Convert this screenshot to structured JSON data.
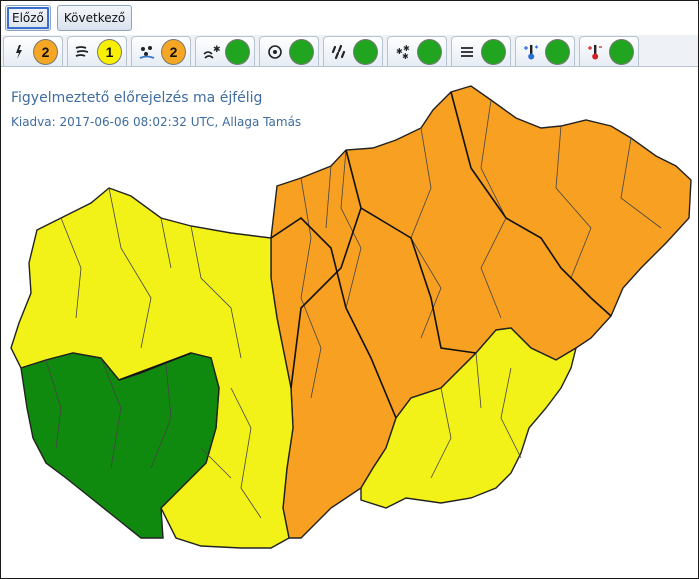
{
  "nav": {
    "prev_label": "Előző",
    "next_label": "Következő"
  },
  "tabs": [
    {
      "icon": "thunderstorm-icon",
      "level": "2",
      "level_color": "#f5a623"
    },
    {
      "icon": "wind-icon",
      "level": "1",
      "level_color": "#f8f000"
    },
    {
      "icon": "rain-icon",
      "level": "2",
      "level_color": "#f5a623"
    },
    {
      "icon": "snow-drift-icon",
      "level": "",
      "level_color": "#21a521"
    },
    {
      "icon": "freezing-rain-icon",
      "level": "",
      "level_color": "#21a521"
    },
    {
      "icon": "heavy-rain-icon",
      "level": "",
      "level_color": "#21a521"
    },
    {
      "icon": "snow-icon",
      "level": "",
      "level_color": "#21a521"
    },
    {
      "icon": "fog-icon",
      "level": "",
      "level_color": "#21a521"
    },
    {
      "icon": "cold-icon",
      "level": "",
      "level_color": "#21a521"
    },
    {
      "icon": "heat-icon",
      "level": "",
      "level_color": "#21a521"
    }
  ],
  "warning": {
    "title": "Figyelmeztető előrejelzés ma éjfélig",
    "issued": "Kiadva: 2017-06-06 08:02:32 UTC, Allaga Tamás"
  },
  "map_colors": {
    "green": "#0f8a0f",
    "yellow": "#f2f219",
    "orange": "#f7a021",
    "border": "#222222"
  }
}
